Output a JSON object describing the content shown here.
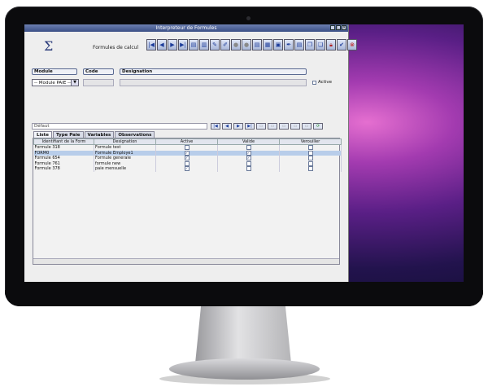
{
  "window": {
    "title": "Interpreteur de Formules"
  },
  "header": {
    "app_title": "Formules de calcul"
  },
  "icons": {
    "toolbar": [
      "first-icon",
      "prev-icon",
      "next-icon",
      "last-icon",
      "doc-icon",
      "doc-icon",
      "doc-edit-icon",
      "edit-icon",
      "circle-icon",
      "circle-icon",
      "doc-icon",
      "doc-icon",
      "doc-icon",
      "pen-icon",
      "doc-icon",
      "copy-icon",
      "copy-icon",
      "lock-icon",
      "check-icon",
      "close-icon"
    ]
  },
  "form": {
    "module_label": "Module",
    "code_label": "Code",
    "designation_label": "Designation",
    "module_value": "-- Module PAIE --",
    "active_label": "Active"
  },
  "filter": {
    "placeholder": "Défaut"
  },
  "tabs": [
    "Liste",
    "Type Paie",
    "Variables",
    "Observations"
  ],
  "table": {
    "columns": [
      "Identifiant de la Form",
      "Designation",
      "Active",
      "Valide",
      "Verouiller"
    ],
    "rows": [
      {
        "id": "Formule 318",
        "designation": "Formule test",
        "active": false,
        "valide": false,
        "verouiller": false
      },
      {
        "id": "FORM0",
        "designation": "Formule Employe1",
        "active": true,
        "valide": true,
        "verouiller": false
      },
      {
        "id": "Formule 654",
        "designation": "Formule generale",
        "active": true,
        "valide": true,
        "verouiller": false
      },
      {
        "id": "Formule 761",
        "designation": "formule new",
        "active": false,
        "valide": false,
        "verouiller": false
      },
      {
        "id": "Formule 378",
        "designation": "paie mensuelle",
        "active": true,
        "valide": false,
        "verouiller": false
      }
    ],
    "selected_row": 1
  },
  "colors": {
    "titlebar": "#3b4f86",
    "accent": "#1c3c9a",
    "selected_row": "#b8cdea"
  }
}
